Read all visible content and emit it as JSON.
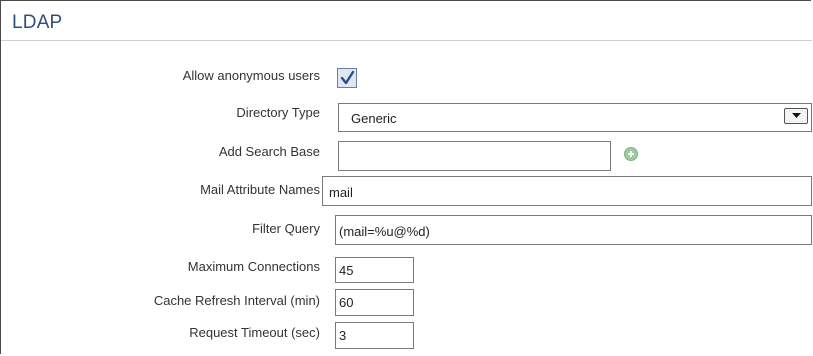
{
  "section": {
    "title": "LDAP"
  },
  "fields": {
    "allow_anonymous": {
      "label": "Allow anonymous users",
      "checked": true
    },
    "directory_type": {
      "label": "Directory Type",
      "value": "Generic"
    },
    "add_search_base": {
      "label": "Add Search Base",
      "value": ""
    },
    "mail_attribute_names": {
      "label": "Mail Attribute Names",
      "value": "mail"
    },
    "filter_query": {
      "label": "Filter Query",
      "value": "(mail=%u@%d)"
    },
    "maximum_connections": {
      "label": "Maximum Connections",
      "value": "45"
    },
    "cache_refresh_interval": {
      "label": "Cache Refresh Interval (min)",
      "value": "60"
    },
    "request_timeout": {
      "label": "Request Timeout (sec)",
      "value": "3"
    }
  },
  "icons": {
    "checkbox_mark": "checkmark-icon",
    "dropdown": "chevron-down-icon",
    "add": "plus-circle-icon"
  },
  "colors": {
    "title": "#2f4f7a",
    "add_icon": "#9ccc9c"
  }
}
